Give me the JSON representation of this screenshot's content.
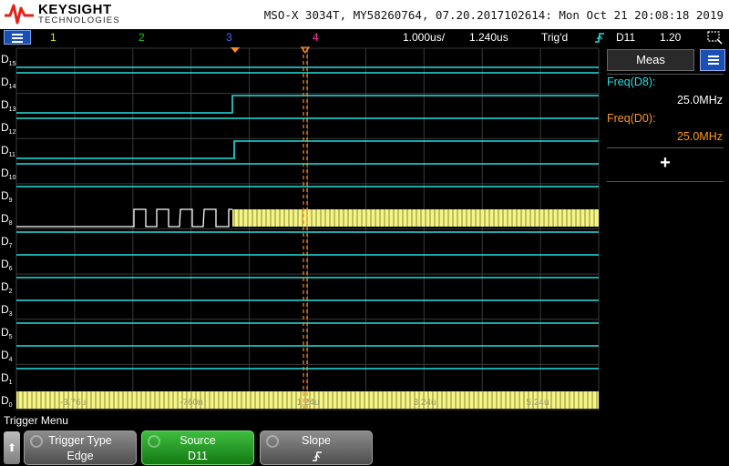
{
  "header": {
    "brand": "KEYSIGHT",
    "brand_sub": "TECHNOLOGIES",
    "info": "MSO-X 3034T, MY58260764, 07.20.2017102614: Mon Oct 21 20:08:18 2019"
  },
  "channel_bar": {
    "channels": [
      {
        "label": "1",
        "color": "#e8e800"
      },
      {
        "label": "2",
        "color": "#22c422"
      },
      {
        "label": "3",
        "color": "#4a6cff"
      },
      {
        "label": "4",
        "color": "#ff3bb0"
      }
    ],
    "timebase": "1.000us/",
    "delay": "1.240us",
    "trigger_status": "Trig'd",
    "trigger_source": "D11",
    "trigger_level": "1.20"
  },
  "digital_channels": [
    {
      "name": "D",
      "sub": "15"
    },
    {
      "name": "D",
      "sub": "14"
    },
    {
      "name": "D",
      "sub": "13"
    },
    {
      "name": "D",
      "sub": "12"
    },
    {
      "name": "D",
      "sub": "11"
    },
    {
      "name": "D",
      "sub": "10"
    },
    {
      "name": "D",
      "sub": "9"
    },
    {
      "name": "D",
      "sub": "8"
    },
    {
      "name": "D",
      "sub": "7"
    },
    {
      "name": "D",
      "sub": "6"
    },
    {
      "name": "D",
      "sub": "2"
    },
    {
      "name": "D",
      "sub": "3"
    },
    {
      "name": "D",
      "sub": "5"
    },
    {
      "name": "D",
      "sub": "4"
    },
    {
      "name": "D",
      "sub": "1"
    },
    {
      "name": "D",
      "sub": "0"
    }
  ],
  "time_labels": [
    "-3.76u",
    "-760n",
    "1.24u",
    "3.24u",
    "5.24u"
  ],
  "colors": {
    "trace": "#22e0e0",
    "bus_fill": "#f4f48a",
    "grid": "#3a3a3a",
    "cursor": "#ff8c1a",
    "meas_d8": "#22e0e0",
    "meas_d0": "#ff9a1a"
  },
  "measurements": {
    "tab": "Meas",
    "items": [
      {
        "label": "Freq(D8):",
        "value": "25.0MHz",
        "color": "#22e0e0"
      },
      {
        "label": "Freq(D0):",
        "value": "25.0MHz",
        "color": "#ff9a1a"
      }
    ],
    "add_icon": "plus-icon"
  },
  "menu": {
    "title": "Trigger Menu",
    "back_icon": "up-arrow-icon",
    "softkeys": [
      {
        "label": "Trigger Type",
        "value": "Edge",
        "style": "gray"
      },
      {
        "label": "Source",
        "value": "D11",
        "style": "green"
      },
      {
        "label": "Slope",
        "value": "rising-edge-icon",
        "style": "gray"
      }
    ]
  }
}
